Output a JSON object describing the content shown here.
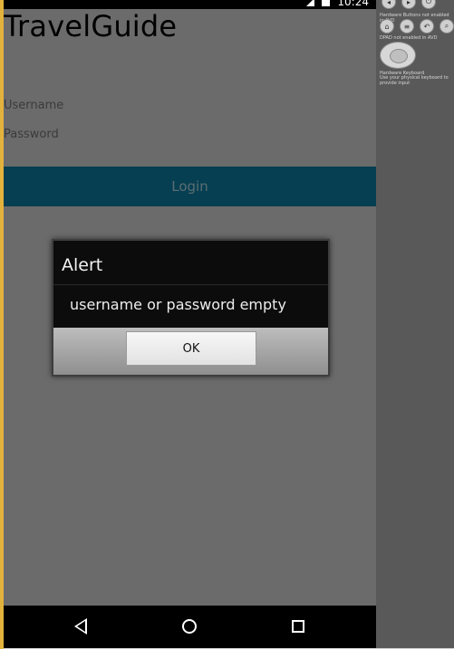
{
  "status_bar": {
    "time": "10:24",
    "icons": [
      "signal-icon",
      "sim-icon"
    ]
  },
  "app": {
    "title": "TravelGuide"
  },
  "form": {
    "username_placeholder": "Username",
    "password_placeholder": "Password",
    "login_label": "Login"
  },
  "alert": {
    "title": "Alert",
    "message": "username or password empty",
    "ok_label": "OK"
  },
  "colors": {
    "login_bg": "#063f52",
    "screen_bg": "#6b6b6b",
    "dialog_bg": "#0c0c0c"
  },
  "emulator_panel": {
    "label_1": "Hardware Buttons not enabled in AVD",
    "label_2": "DPAD not enabled in AVD",
    "label_3": "Hardware Keyboard",
    "label_4": "Use your physical keyboard to provide input"
  }
}
